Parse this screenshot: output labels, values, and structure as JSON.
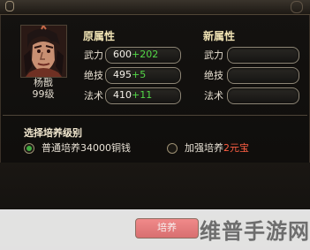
{
  "character": {
    "name": "杨戬",
    "level": "99级"
  },
  "sections": {
    "original_title": "原属性",
    "new_title": "新属性"
  },
  "stats": {
    "original": [
      {
        "label": "武力",
        "base": "600",
        "bonus": "+202"
      },
      {
        "label": "绝技",
        "base": "495",
        "bonus": "+5"
      },
      {
        "label": "法术",
        "base": "410",
        "bonus": "+11"
      }
    ],
    "new": [
      {
        "label": "武力",
        "value": ""
      },
      {
        "label": "绝技",
        "value": ""
      },
      {
        "label": "法术",
        "value": ""
      }
    ]
  },
  "cultivation": {
    "title": "选择培养级别",
    "options": [
      {
        "label": "普通培养34000铜钱",
        "selected": true
      },
      {
        "label_prefix": "加强培养",
        "cost": "2元宝",
        "selected": false
      }
    ]
  },
  "action": {
    "button_label": "培养"
  },
  "watermark": "维普手游网",
  "icons": {
    "portrait": "character-portrait"
  },
  "colors": {
    "bonus": "#53d947",
    "cost": "#ff5f43",
    "selected": "#40ac41"
  }
}
